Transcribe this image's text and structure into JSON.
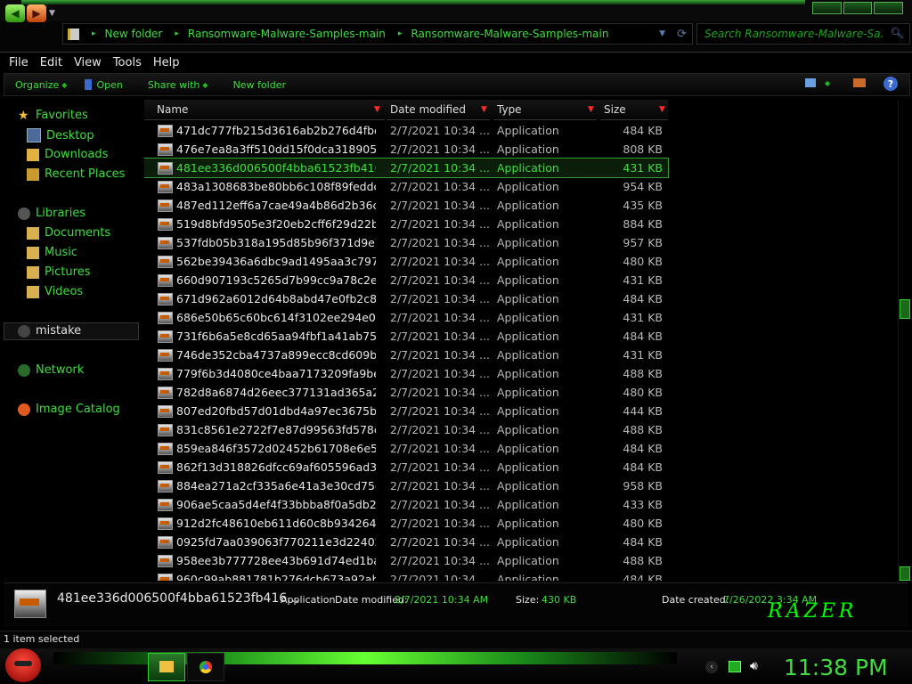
{
  "nav": {
    "back": "◀",
    "forward": "▶",
    "breadcrumb": [
      "New folder",
      "Ransomware-Malware-Samples-main",
      "Ransomware-Malware-Samples-main"
    ],
    "search_placeholder": "Search Ransomware-Malware-Sa..."
  },
  "menu": [
    "File",
    "Edit",
    "View",
    "Tools",
    "Help"
  ],
  "commands": {
    "organize": "Organize",
    "open": "Open",
    "share_with": "Share with",
    "new_folder": "New folder"
  },
  "sidebar": {
    "favorites": "Favorites",
    "favorites_items": [
      "Desktop",
      "Downloads",
      "Recent Places"
    ],
    "libraries": "Libraries",
    "libraries_items": [
      "Documents",
      "Music",
      "Pictures",
      "Videos"
    ],
    "mistake": "mistake",
    "network": "Network",
    "image_catalog": "Image Catalog"
  },
  "columns": {
    "name": "Name",
    "date": "Date modified",
    "type": "Type",
    "size": "Size"
  },
  "files": [
    {
      "name": "471dc777fb215d3616ab2b276d4fbe3...",
      "date": "2/7/2021 10:34 ...",
      "type": "Application",
      "size": "484 KB"
    },
    {
      "name": "476e7ea8a3ff510dd15f0dca3189058f...",
      "date": "2/7/2021 10:34 ...",
      "type": "Application",
      "size": "808 KB"
    },
    {
      "name": "481ee336d006500f4bba61523fb416d...",
      "date": "2/7/2021 10:34 ...",
      "type": "Application",
      "size": "431 KB"
    },
    {
      "name": "483a1308683be80bb6c108f89feddc7...",
      "date": "2/7/2021 10:34 ...",
      "type": "Application",
      "size": "954 KB"
    },
    {
      "name": "487ed112eff6a7cae49a4b86d2b36c3...",
      "date": "2/7/2021 10:34 ...",
      "type": "Application",
      "size": "435 KB"
    },
    {
      "name": "519d8bfd9505e3f20eb2cff6f29d22b41...",
      "date": "2/7/2021 10:34 ...",
      "type": "Application",
      "size": "884 KB"
    },
    {
      "name": "537fdb05b318a195d85b96f371d9e7e...",
      "date": "2/7/2021 10:34 ...",
      "type": "Application",
      "size": "957 KB"
    },
    {
      "name": "562be39436a6dbc9ad1495aa3c7972...",
      "date": "2/7/2021 10:34 ...",
      "type": "Application",
      "size": "480 KB"
    },
    {
      "name": "660d907193c5265d7b99cc9a78c2e4...",
      "date": "2/7/2021 10:34 ...",
      "type": "Application",
      "size": "431 KB"
    },
    {
      "name": "671d962a6012d64b8abd47e0fb2c8fb...",
      "date": "2/7/2021 10:34 ...",
      "type": "Application",
      "size": "484 KB"
    },
    {
      "name": "686e50b65c60bc614f3102ee294e042...",
      "date": "2/7/2021 10:34 ...",
      "type": "Application",
      "size": "431 KB"
    },
    {
      "name": "731f6b6a5e8cd65aa94fbf1a41ab757e...",
      "date": "2/7/2021 10:34 ...",
      "type": "Application",
      "size": "484 KB"
    },
    {
      "name": "746de352cba4737a899ecc8cd609bb...",
      "date": "2/7/2021 10:34 ...",
      "type": "Application",
      "size": "431 KB"
    },
    {
      "name": "779f6b3d4080ce4baa7173209fa9bec...",
      "date": "2/7/2021 10:34 ...",
      "type": "Application",
      "size": "488 KB"
    },
    {
      "name": "782d8a6874d26eec377131ad365a24...",
      "date": "2/7/2021 10:34 ...",
      "type": "Application",
      "size": "480 KB"
    },
    {
      "name": "807ed20fbd57d01dbd4a97ec3675b91...",
      "date": "2/7/2021 10:34 ...",
      "type": "Application",
      "size": "444 KB"
    },
    {
      "name": "831c8561e2722f7e87d99563fd578c5...",
      "date": "2/7/2021 10:34 ...",
      "type": "Application",
      "size": "488 KB"
    },
    {
      "name": "859ea846f3572d02452b61708e6e5f2...",
      "date": "2/7/2021 10:34 ...",
      "type": "Application",
      "size": "484 KB"
    },
    {
      "name": "862f13d318826dfcc69af605596ad3a9...",
      "date": "2/7/2021 10:34 ...",
      "type": "Application",
      "size": "484 KB"
    },
    {
      "name": "884ea271a2cf335a6e41a3e30cd75e8...",
      "date": "2/7/2021 10:34 ...",
      "type": "Application",
      "size": "958 KB"
    },
    {
      "name": "906ae5caa5d4ef4f33bbba8f0a5db2e5...",
      "date": "2/7/2021 10:34 ...",
      "type": "Application",
      "size": "433 KB"
    },
    {
      "name": "912d2fc48610eb611d60c8b93426477...",
      "date": "2/7/2021 10:34 ...",
      "type": "Application",
      "size": "480 KB"
    },
    {
      "name": "0925fd7aa039063f770211e3d224024...",
      "date": "2/7/2021 10:34 ...",
      "type": "Application",
      "size": "484 KB"
    },
    {
      "name": "958ee3b777728ee43b691d74ed1ba1...",
      "date": "2/7/2021 10:34 ...",
      "type": "Application",
      "size": "488 KB"
    },
    {
      "name": "960c99ab881781b276dcb673a92ab8f...",
      "date": "2/7/2021 10:34 ...",
      "type": "Application",
      "size": "484 KB"
    }
  ],
  "selected_index": 2,
  "details": {
    "name": "481ee336d006500f4bba61523fb416...",
    "type": "Application",
    "date_modified_label": "Date modified:",
    "date_modified": "2/7/2021 10:34 AM",
    "size_label": "Size:",
    "size": "430 KB",
    "date_created_label": "Date created:",
    "date_created": "7/26/2022 3:34 AM"
  },
  "razer_logo": "RAZER",
  "status": "1 item selected",
  "clock": "11:38 PM",
  "colors": {
    "accent": "#3fdc3f",
    "background": "#000000",
    "selection": "#3b9a3b",
    "dropdown": "#ff2a2a"
  },
  "icons": [
    "back-arrow-icon",
    "forward-arrow-icon",
    "folder-icon",
    "refresh-icon",
    "search-icon",
    "help-icon",
    "application-icon",
    "angry-bird-start-icon",
    "chrome-icon",
    "volume-icon",
    "network-icon"
  ]
}
